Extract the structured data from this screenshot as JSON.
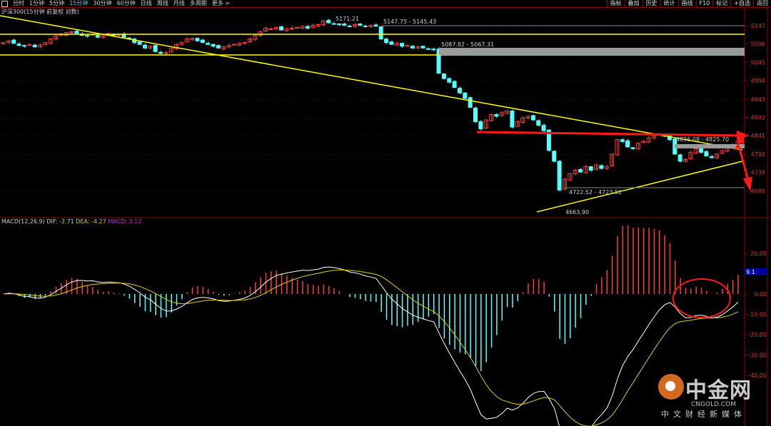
{
  "toolbar": {
    "timeframes": [
      "分时",
      "1分钟",
      "5分钟",
      "15分钟",
      "30分钟",
      "60分钟",
      "日线",
      "周线",
      "月线",
      "多周期",
      "更多 >"
    ],
    "active": "15分钟",
    "right_buttons": [
      "指标",
      "叠加",
      "历史",
      "统计",
      "画线",
      "F10",
      "标记",
      "+自选",
      "返回"
    ]
  },
  "title": "沪深300(15分钟 前复权 对数)",
  "macd_legend": {
    "name": "MACD(12,26,9)",
    "dif": "DIF: -2.71",
    "dea": "DEA: -4.27",
    "macd": "MACD: 3.12"
  },
  "cursor_value": "9.1",
  "annotations": {
    "high": "5171.21",
    "range1": "5147.75 - 5145.43",
    "range2": "5087.82 - 5067.31",
    "range3": "4836.08 - 4825.70",
    "range4": "4722.52 - 4723.51",
    "low": "4663.90"
  },
  "logo": {
    "cn": "中金网",
    "en": "CNGOLD.COM",
    "sub": "中文财经新媒体"
  },
  "colors": {
    "up": "#ff3c3c",
    "down": "#54ffff",
    "trend": "#ffff00",
    "arrow": "#ff1a1a",
    "dif": "#ffffff",
    "dea": "#e0d000"
  },
  "chart_data": {
    "type": "candlestick",
    "title": "沪深300 15分钟",
    "price_ticks": [
      5147,
      5096,
      5045,
      4994,
      4943,
      4892,
      4841,
      4790,
      4739,
      4688
    ],
    "macd_ticks": [
      "20.00",
      "0.00",
      "-10.00",
      "-20.00",
      "-30.00",
      "-40.00"
    ],
    "macd_tick_values": [
      20,
      0,
      -10,
      -20,
      -30,
      -40
    ],
    "close": [
      5100,
      5105,
      5098,
      5092,
      5090,
      5095,
      5088,
      5093,
      5100,
      5110,
      5118,
      5122,
      5128,
      5130,
      5126,
      5120,
      5118,
      5122,
      5115,
      5118,
      5125,
      5120,
      5122,
      5115,
      5110,
      5100,
      5095,
      5085,
      5090,
      5075,
      5070,
      5072,
      5085,
      5095,
      5100,
      5110,
      5112,
      5105,
      5100,
      5095,
      5090,
      5085,
      5088,
      5092,
      5095,
      5098,
      5100,
      5110,
      5120,
      5130,
      5140,
      5138,
      5142,
      5135,
      5138,
      5140,
      5142,
      5145,
      5140,
      5148,
      5150,
      5160,
      5155,
      5152,
      5150,
      5148,
      5145,
      5150,
      5148,
      5145,
      5147,
      5146,
      5110,
      5100,
      5095,
      5098,
      5090,
      5092,
      5085,
      5088,
      5085,
      5082,
      5080,
      5015,
      5000,
      4990,
      4975,
      4960,
      4945,
      4920,
      4880,
      4860,
      4885,
      4900,
      4895,
      4905,
      4910,
      4865,
      4880,
      4890,
      4895,
      4885,
      4870,
      4855,
      4800,
      4770,
      4690,
      4720,
      4735,
      4745,
      4740,
      4755,
      4745,
      4760,
      4750,
      4755,
      4790,
      4830,
      4825,
      4810,
      4805,
      4820,
      4825,
      4835,
      4840,
      4845,
      4840,
      4830,
      4790,
      4770,
      4775,
      4795,
      4805,
      4795,
      4785,
      4780,
      4790,
      4800,
      4810,
      4815,
      4825
    ]
  }
}
